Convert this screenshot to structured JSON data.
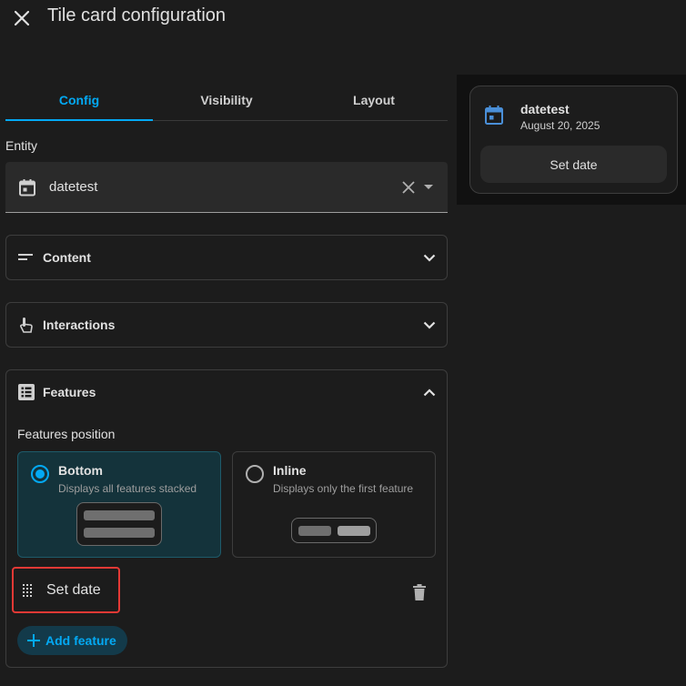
{
  "dialog": {
    "title": "Tile card configuration"
  },
  "tabs": [
    {
      "label": "Config",
      "active": true
    },
    {
      "label": "Visibility",
      "active": false
    },
    {
      "label": "Layout",
      "active": false
    }
  ],
  "entity": {
    "label": "Entity",
    "value": "datetest",
    "icon": "calendar-icon"
  },
  "panels": {
    "content": {
      "title": "Content",
      "icon": "text-short-icon",
      "expanded": false
    },
    "interactions": {
      "title": "Interactions",
      "icon": "gesture-tap-icon",
      "expanded": false
    },
    "features": {
      "title": "Features",
      "icon": "list-box-icon",
      "expanded": true
    }
  },
  "features_position": {
    "label": "Features position",
    "options": [
      {
        "title": "Bottom",
        "description": "Displays all features stacked",
        "selected": true
      },
      {
        "title": "Inline",
        "description": "Displays only the first feature",
        "selected": false
      }
    ]
  },
  "feature_list": [
    {
      "name": "Set date",
      "highlighted": true
    }
  ],
  "add_feature": {
    "label": "Add feature"
  },
  "tile_preview": {
    "name": "datetest",
    "state": "August 20, 2025",
    "button": "Set date"
  },
  "colors": {
    "accent": "#03a9f4",
    "background": "#1c1c1c",
    "highlight": "#e53935",
    "entity_icon": "#4a8fd8"
  }
}
